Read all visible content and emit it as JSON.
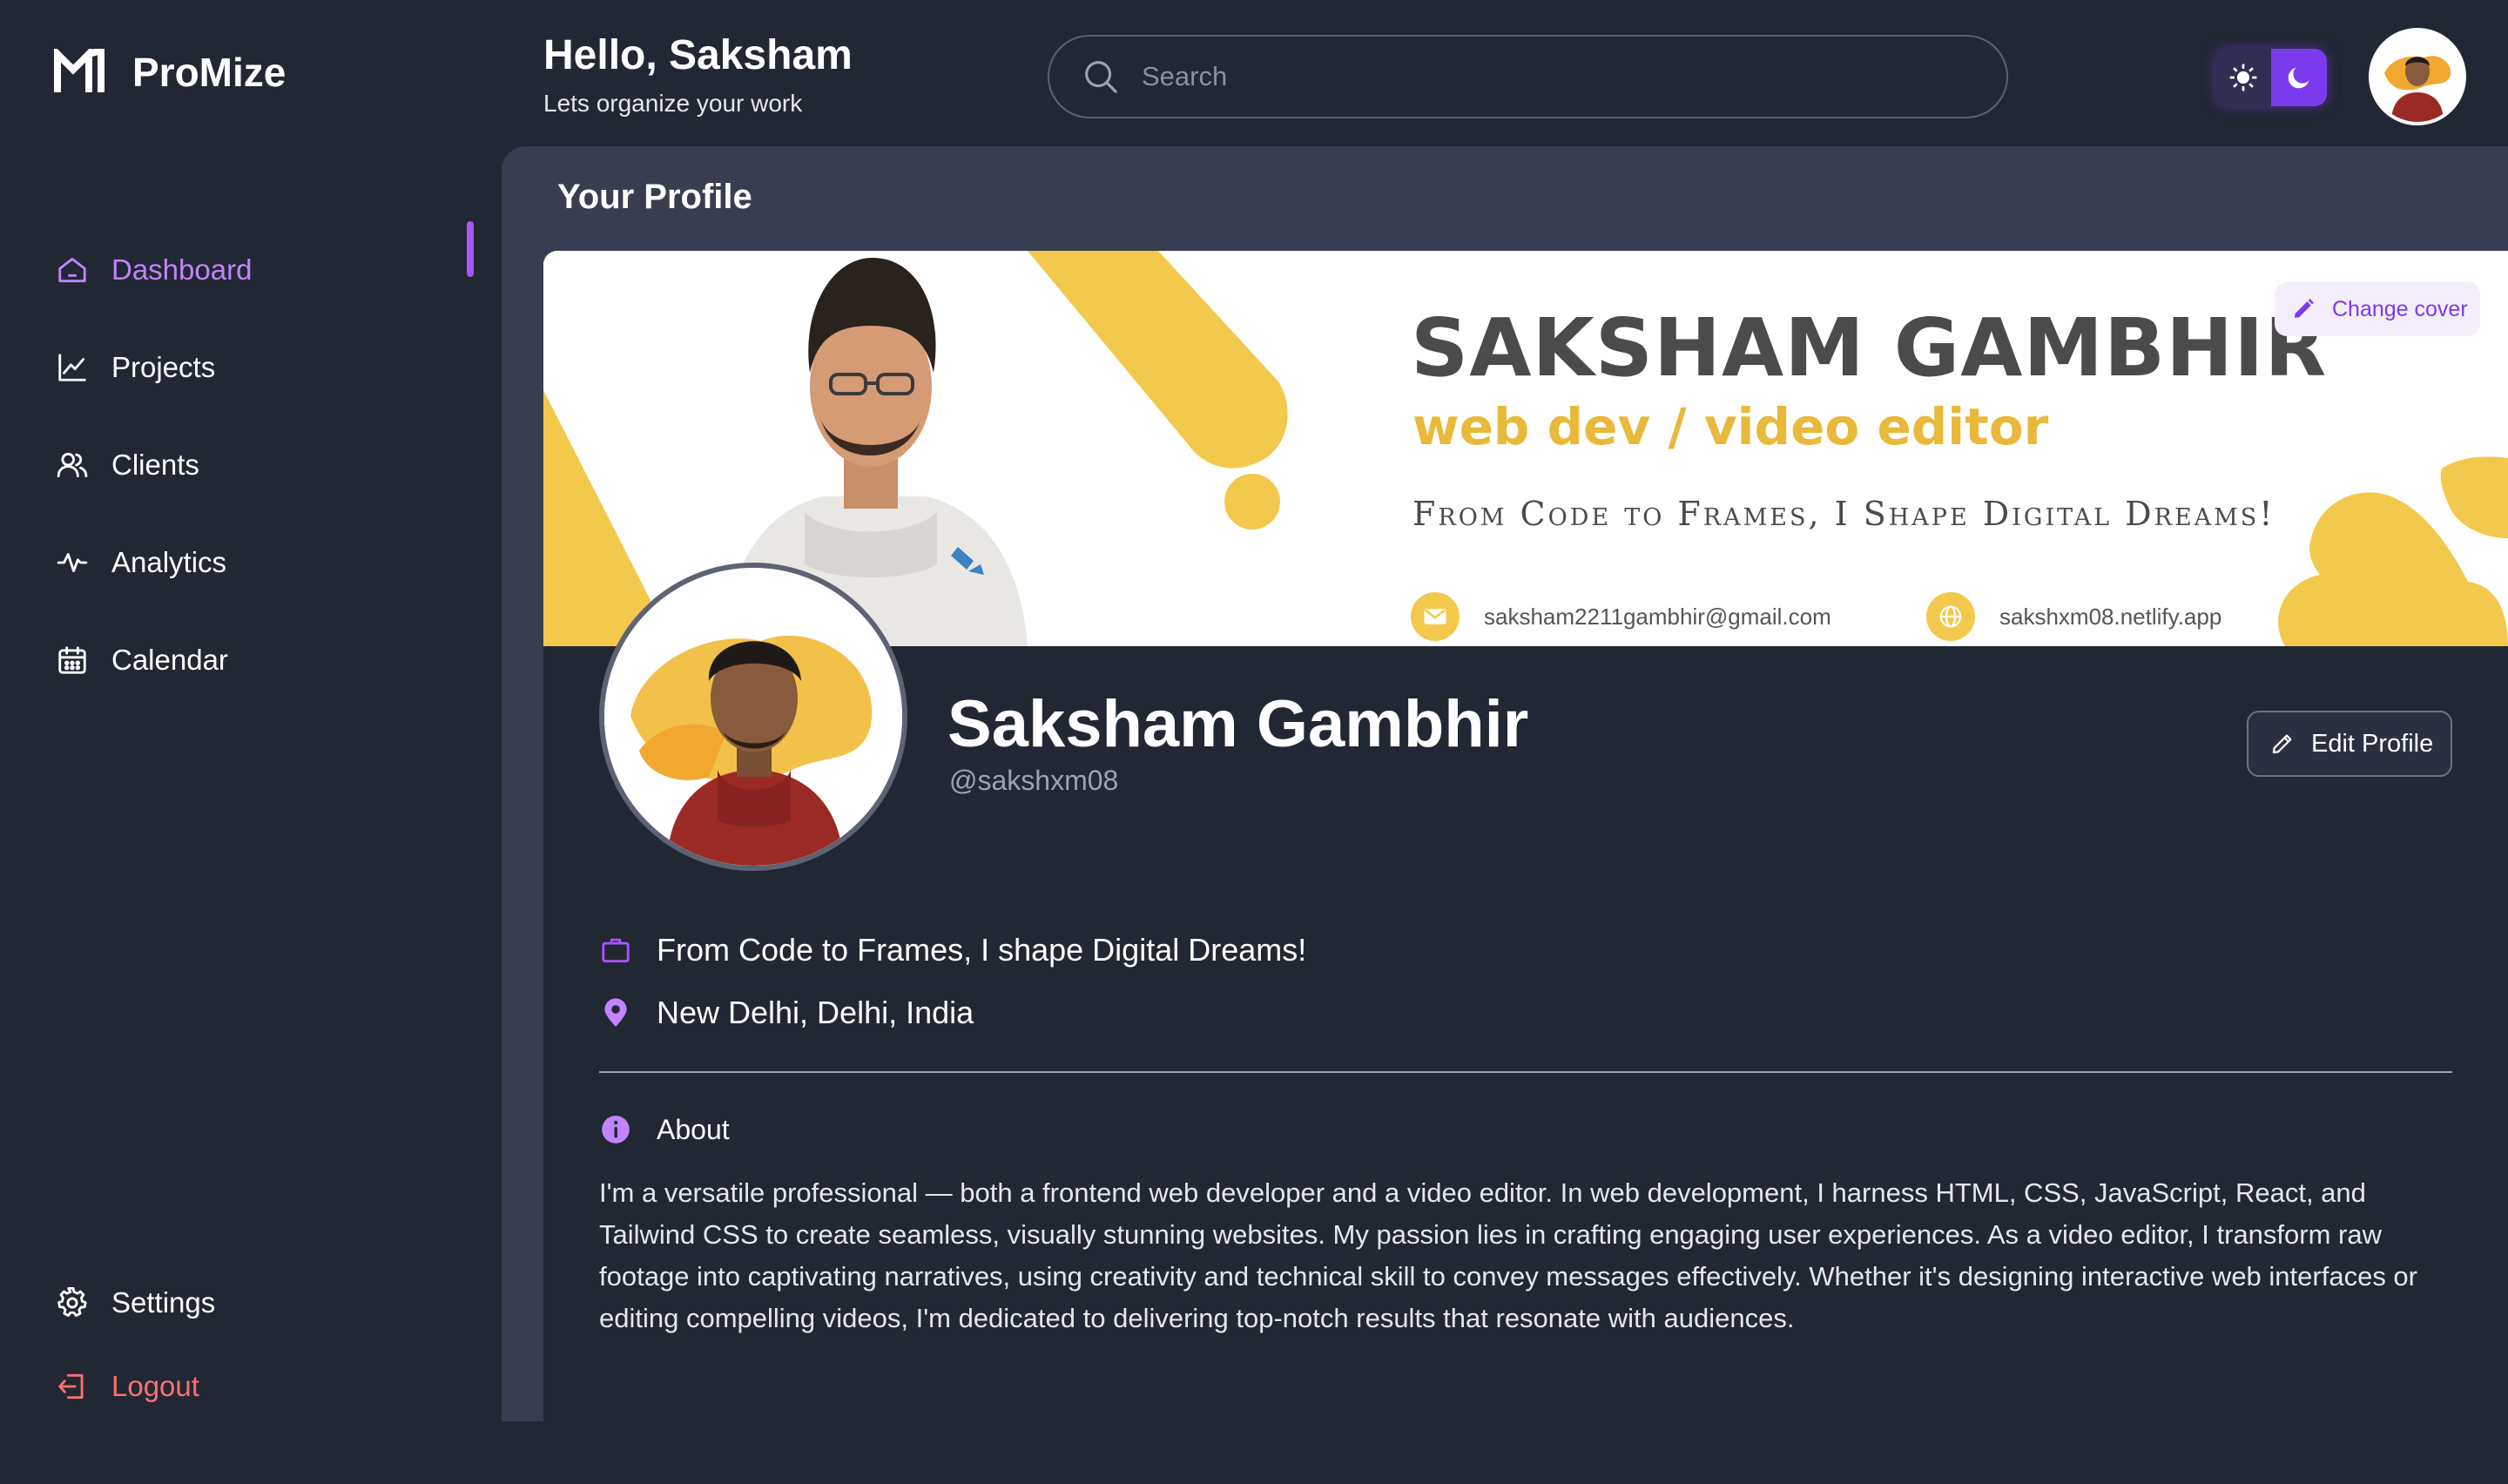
{
  "app": {
    "name": "ProMize"
  },
  "header": {
    "greeting": "Hello, Saksham",
    "subtitle": "Lets organize your work",
    "search_placeholder": "Search"
  },
  "sidebar": {
    "items": [
      {
        "label": "Dashboard",
        "icon": "home-icon",
        "active": true
      },
      {
        "label": "Projects",
        "icon": "chart-line-icon"
      },
      {
        "label": "Clients",
        "icon": "users-icon"
      },
      {
        "label": "Analytics",
        "icon": "activity-icon"
      },
      {
        "label": "Calendar",
        "icon": "calendar-icon"
      }
    ],
    "bottom": [
      {
        "label": "Settings",
        "icon": "gear-icon"
      },
      {
        "label": "Logout",
        "icon": "logout-icon"
      }
    ]
  },
  "theme_toggle": {
    "options": [
      "sun-icon",
      "moon-icon"
    ],
    "selected": "dark"
  },
  "page": {
    "title": "Your Profile"
  },
  "cover": {
    "name": "SAKSHAM GAMBHIR",
    "role": "web dev / video editor",
    "tagline": "From Code to Frames, I Shape Digital Dreams!",
    "email": "saksham2211gambhir@gmail.com",
    "website": "sakshxm08.netlify.app",
    "change_cover_label": "Change cover"
  },
  "profile": {
    "name": "Saksham Gambhir",
    "handle": "@sakshxm08",
    "edit_label": "Edit Profile",
    "headline": "From Code to Frames, I shape Digital Dreams!",
    "location": "New Delhi, Delhi, India",
    "about_label": "About",
    "about_text": "I'm a versatile professional — both a frontend web developer and a video editor. In web development, I harness HTML, CSS, JavaScript, React, and Tailwind CSS to create seamless, visually stunning websites. My passion lies in crafting engaging user experiences. As a video editor, I transform raw footage into captivating narratives, using creativity and technical skill to convey messages effectively. Whether it's designing interactive web interfaces or editing compelling videos, I'm dedicated to delivering top-notch results that resonate with audiences."
  },
  "colors": {
    "background": "#222734",
    "panel": "#383e4f",
    "accent": "#a855f7",
    "accent_text": "#c084fc",
    "danger": "#f87171",
    "cover_yellow": "#f2c94c"
  }
}
